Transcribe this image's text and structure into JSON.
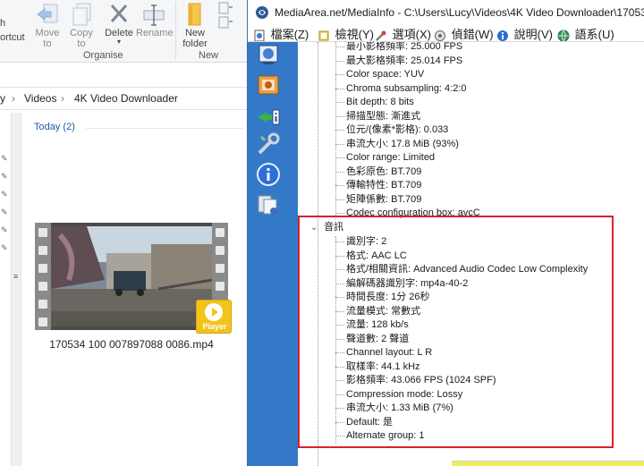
{
  "explorer": {
    "ribbon": {
      "shortcut_partial": "h",
      "shortcut_partial2": "ortcut",
      "move_to": "Move",
      "move_to2": "to",
      "copy_to": "Copy",
      "copy_to2": "to",
      "delete": "Delete",
      "rename": "Rename",
      "new_folder": "New",
      "new_folder2": "folder",
      "group_organise": "Organise",
      "group_new": "New"
    },
    "breadcrumb": {
      "prefix": "y",
      "sep1": "›",
      "videos": "Videos",
      "sep2": "›",
      "folder": "4K Video Downloader"
    },
    "group_today": "Today (2)",
    "file": {
      "name": "170534 100 007897088 0086.mp4",
      "badge": "Player"
    }
  },
  "mediainfo": {
    "title": "MediaArea.net/MediaInfo - C:\\Users\\Lucy\\Videos\\4K Video Downloader\\170534 10",
    "menu": [
      {
        "label": "檔案(Z)",
        "icon": "file-menu-icon"
      },
      {
        "label": "檢視(Y)",
        "icon": "view-menu-icon"
      },
      {
        "label": "選項(X)",
        "icon": "options-menu-icon"
      },
      {
        "label": "偵錯(W)",
        "icon": "debug-menu-icon"
      },
      {
        "label": "說明(V)",
        "icon": "help-menu-icon"
      },
      {
        "label": "語系(U)",
        "icon": "language-menu-icon"
      }
    ],
    "video_rows": [
      "最小影格頻率: 25.000 FPS",
      "最大影格頻率: 25.014 FPS",
      "Color space: YUV",
      "Chroma subsampling: 4:2:0",
      "Bit depth: 8 bits",
      "掃描型態: 漸進式",
      "位元/(像素*影格): 0.033",
      "串流大小: 17.8 MiB (93%)",
      "Color range: Limited",
      "色彩原色: BT.709",
      "傳輸特性: BT.709",
      "矩陣係數: BT.709",
      "Codec configuration box: avcC"
    ],
    "audio_section": "音訊",
    "audio_rows": [
      "識別字: 2",
      "格式: AAC LC",
      "格式/相關資訊: Advanced Audio Codec Low Complexity",
      "編解碼器識別字: mp4a-40-2",
      "時間長度: 1分 26秒",
      "流量模式: 常數式",
      "流量: 128 kb/s",
      "聲道數: 2 聲道",
      "Channel layout: L R",
      "取樣率: 44.1 kHz",
      "影格頻率: 43.066 FPS (1024 SPF)",
      "Compression mode: Lossy",
      "串流大小: 1.33 MiB (7%)",
      "Default: 是",
      "Alternate group: 1"
    ]
  },
  "colors": {
    "toolbar": "#3478c8",
    "highlight": "#d6232a",
    "link": "#1e5aa8"
  }
}
